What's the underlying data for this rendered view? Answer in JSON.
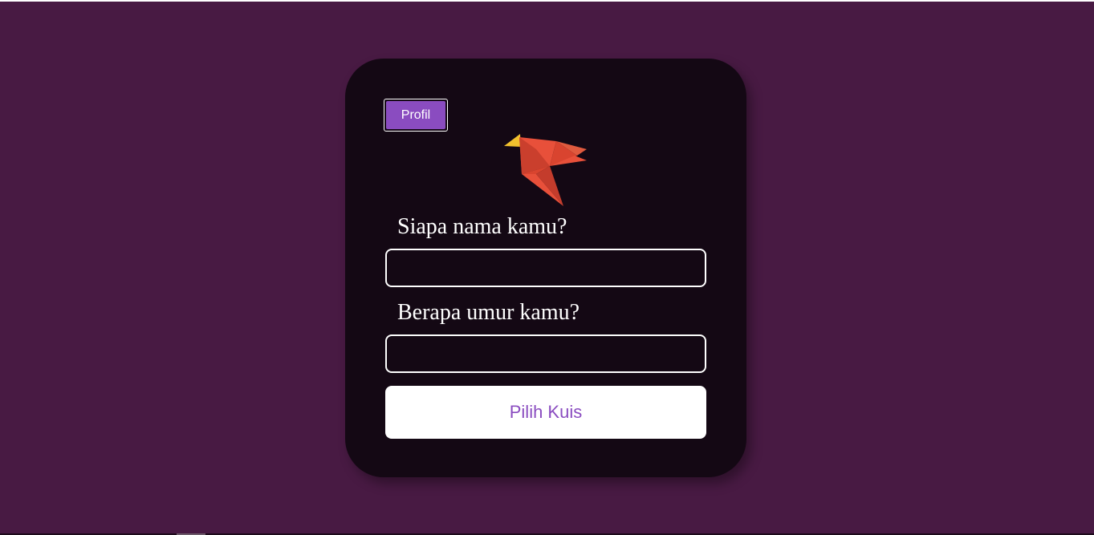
{
  "header": {
    "profile_label": "Profil"
  },
  "logo": {
    "icon": "origami-bird-icon",
    "colors": {
      "beak": "#f2c12e",
      "body": "#e8503a",
      "shade": "#c43c2c",
      "wing": "#d9442f"
    }
  },
  "form": {
    "name_label": "Siapa nama kamu?",
    "name_value": "",
    "age_label": "Berapa umur kamu?",
    "age_value": "",
    "submit_label": "Pilih Kuis"
  },
  "theme": {
    "background": "#481a43",
    "card": "#140814",
    "accent": "#8a4cc0",
    "text": "#ffffff"
  }
}
